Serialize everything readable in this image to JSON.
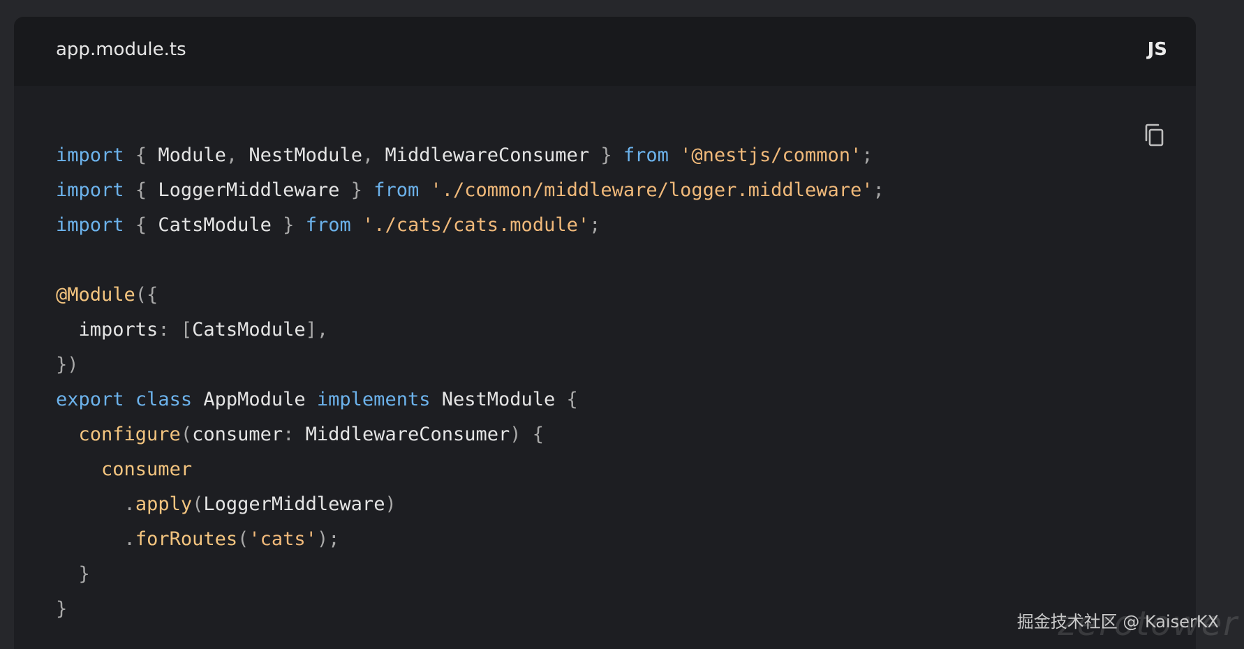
{
  "header": {
    "filename": "app.module.ts",
    "language": "JS"
  },
  "copy_button": {
    "icon": "copy-icon"
  },
  "colors": {
    "page_background": "#26272b",
    "card_background": "#1d1e22",
    "header_background": "#18191c",
    "keyword": "#6cb2eb",
    "string": "#f0b97a",
    "function": "#f3c47f",
    "punctuation": "#a8a8a8",
    "text": "#e4e4e4"
  },
  "code": {
    "lines": [
      [
        [
          "kw",
          "import"
        ],
        [
          "plain",
          " "
        ],
        [
          "punc",
          "{"
        ],
        [
          "plain",
          " Module"
        ],
        [
          "punc",
          ","
        ],
        [
          "plain",
          " NestModule"
        ],
        [
          "punc",
          ","
        ],
        [
          "plain",
          " MiddlewareConsumer "
        ],
        [
          "punc",
          "}"
        ],
        [
          "plain",
          " "
        ],
        [
          "kw",
          "from"
        ],
        [
          "plain",
          " "
        ],
        [
          "str",
          "'@nestjs/common'"
        ],
        [
          "punc",
          ";"
        ]
      ],
      [
        [
          "kw",
          "import"
        ],
        [
          "plain",
          " "
        ],
        [
          "punc",
          "{"
        ],
        [
          "plain",
          " LoggerMiddleware "
        ],
        [
          "punc",
          "}"
        ],
        [
          "plain",
          " "
        ],
        [
          "kw",
          "from"
        ],
        [
          "plain",
          " "
        ],
        [
          "str",
          "'./common/middleware/logger.middleware'"
        ],
        [
          "punc",
          ";"
        ]
      ],
      [
        [
          "kw",
          "import"
        ],
        [
          "plain",
          " "
        ],
        [
          "punc",
          "{"
        ],
        [
          "plain",
          " CatsModule "
        ],
        [
          "punc",
          "}"
        ],
        [
          "plain",
          " "
        ],
        [
          "kw",
          "from"
        ],
        [
          "plain",
          " "
        ],
        [
          "str",
          "'./cats/cats.module'"
        ],
        [
          "punc",
          ";"
        ]
      ],
      [],
      [
        [
          "dec",
          "@Module"
        ],
        [
          "punc",
          "({"
        ]
      ],
      [
        [
          "plain",
          "  imports"
        ],
        [
          "punc",
          ":"
        ],
        [
          "plain",
          " "
        ],
        [
          "punc",
          "["
        ],
        [
          "plain",
          "CatsModule"
        ],
        [
          "punc",
          "],"
        ]
      ],
      [
        [
          "punc",
          "})"
        ]
      ],
      [
        [
          "kw",
          "export"
        ],
        [
          "plain",
          " "
        ],
        [
          "kw",
          "class"
        ],
        [
          "plain",
          " AppModule "
        ],
        [
          "kw",
          "implements"
        ],
        [
          "plain",
          " NestModule "
        ],
        [
          "punc",
          "{"
        ]
      ],
      [
        [
          "plain",
          "  "
        ],
        [
          "fn",
          "configure"
        ],
        [
          "punc",
          "("
        ],
        [
          "plain",
          "consumer"
        ],
        [
          "punc",
          ":"
        ],
        [
          "plain",
          " MiddlewareConsumer"
        ],
        [
          "punc",
          ")"
        ],
        [
          "plain",
          " "
        ],
        [
          "punc",
          "{"
        ]
      ],
      [
        [
          "plain",
          "    "
        ],
        [
          "fn",
          "consumer"
        ]
      ],
      [
        [
          "plain",
          "      "
        ],
        [
          "punc",
          "."
        ],
        [
          "fn",
          "apply"
        ],
        [
          "punc",
          "("
        ],
        [
          "plain",
          "LoggerMiddleware"
        ],
        [
          "punc",
          ")"
        ]
      ],
      [
        [
          "plain",
          "      "
        ],
        [
          "punc",
          "."
        ],
        [
          "fn",
          "forRoutes"
        ],
        [
          "punc",
          "("
        ],
        [
          "str",
          "'cats'"
        ],
        [
          "punc",
          ");"
        ]
      ],
      [
        [
          "plain",
          "  "
        ],
        [
          "punc",
          "}"
        ]
      ],
      [
        [
          "punc",
          "}"
        ]
      ]
    ]
  },
  "watermark": {
    "text": "掘金技术社区 @ KaiserKX",
    "ghost_text": "zerotower"
  }
}
